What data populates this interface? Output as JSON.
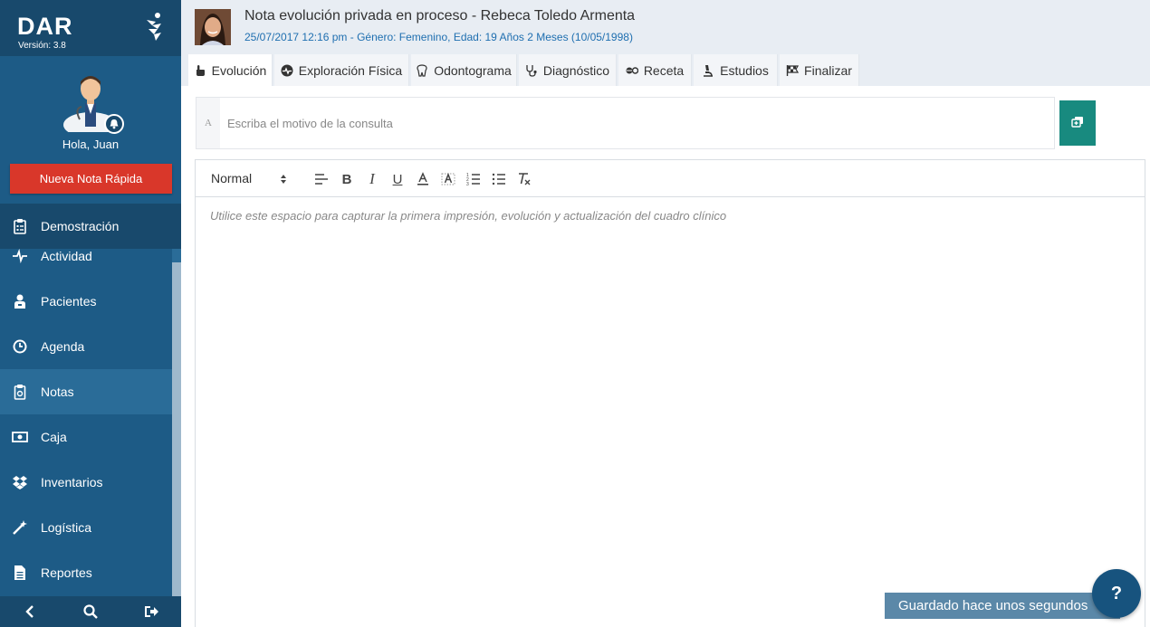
{
  "sidebar": {
    "brand_name": "DAR",
    "version": "Versión: 3.8",
    "greeting": "Hola, Juan",
    "quick_note_label": "Nueva Nota Rápida",
    "demo_label": "Demostración",
    "items": [
      {
        "label": "Actividad",
        "icon": "pulse-icon"
      },
      {
        "label": "Pacientes",
        "icon": "user-icon"
      },
      {
        "label": "Agenda",
        "icon": "clock-icon"
      },
      {
        "label": "Notas",
        "icon": "clipboard-icon",
        "active": true
      },
      {
        "label": "Caja",
        "icon": "money-icon"
      },
      {
        "label": "Inventarios",
        "icon": "dropbox-icon"
      },
      {
        "label": "Logística",
        "icon": "magic-wand-icon"
      },
      {
        "label": "Reportes",
        "icon": "document-icon"
      }
    ],
    "bottom": [
      "chevron-left-icon",
      "search-icon",
      "sign-out-icon"
    ]
  },
  "header": {
    "title": "Nota evolución privada en proceso - Rebeca Toledo Armenta",
    "subtitle": "25/07/2017 12:16 pm - Género: Femenino, Edad: 19 Años 2 Meses (10/05/1998)",
    "tabs": [
      {
        "label": "Evolución",
        "icon": "hand-pointer-icon",
        "active": true
      },
      {
        "label": "Exploración Física",
        "icon": "heartbeat-circle-icon"
      },
      {
        "label": "Odontograma",
        "icon": "tooth-icon"
      },
      {
        "label": "Diagnóstico",
        "icon": "stethoscope-icon"
      },
      {
        "label": "Receta",
        "icon": "pills-icon"
      },
      {
        "label": "Estudios",
        "icon": "microscope-icon"
      },
      {
        "label": "Finalizar",
        "icon": "flag-checkered-icon"
      }
    ]
  },
  "reason": {
    "prefix": "A",
    "placeholder": "Escriba el motivo de la consulta",
    "value": ""
  },
  "editor": {
    "format": "Normal",
    "toolbar": [
      "align-icon",
      "bold-icon",
      "italic-icon",
      "underline-icon",
      "text-color-icon",
      "background-color-icon",
      "ordered-list-icon",
      "bullet-list-icon",
      "clear-format-icon"
    ],
    "placeholder": "Utilice este espacio para capturar la primera impresión, evolución y actualización del cuadro clínico"
  },
  "status": {
    "saved_label": "Guardado hace unos segundos",
    "help_label": "?"
  },
  "colors": {
    "sidebar": "#1d5b86",
    "sidebar_dark": "#18496c",
    "accent_red": "#d9372a",
    "teal": "#188a7f",
    "link_blue": "#1f6fb0"
  }
}
